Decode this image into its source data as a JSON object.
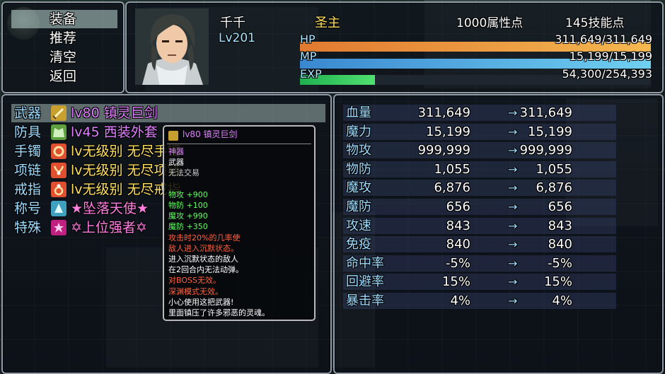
{
  "menu": {
    "items": [
      {
        "label": "装备",
        "selected": true
      },
      {
        "label": "推荐"
      },
      {
        "label": "清空"
      },
      {
        "label": "返回"
      }
    ]
  },
  "character": {
    "name": "千千",
    "title": "圣主",
    "level": "Lv201",
    "attribute_points": "1000属性点",
    "skill_points": "145技能点",
    "hp_label": "HP",
    "hp_value": "311,649/311,649",
    "hp_ratio": 1.0,
    "mp_label": "MP",
    "mp_value": "15,199/15,199",
    "mp_ratio": 1.0,
    "exp_label": "EXP",
    "exp_value": "54,300/254,393",
    "exp_ratio": 0.2134,
    "colors": {
      "hp": "#f0a040",
      "mp": "#50b8e8",
      "exp": "#30d060",
      "title": "#ffe060",
      "level": "#a9e4ff"
    }
  },
  "equipment": {
    "slots": [
      {
        "label": "武器",
        "item": "lv80 镇灵巨剑",
        "icon": "sword-icon",
        "icon_color": "#c8a030",
        "item_color": "#e080ff",
        "selected": true
      },
      {
        "label": "防具",
        "item": "lv45 西装外套",
        "icon": "armor-icon",
        "icon_color": "#60a040",
        "item_color": "#e080ff"
      },
      {
        "label": "手镯",
        "item": "lv无级别 无尽手镯",
        "icon": "bracelet-icon",
        "icon_color": "#e05030",
        "item_color": "#ffe060"
      },
      {
        "label": "项链",
        "item": "lv无级别 无尽项链",
        "icon": "necklace-icon",
        "icon_color": "#e05030",
        "item_color": "#ffe060"
      },
      {
        "label": "戒指",
        "item": "lv无级别 无尽戒指",
        "icon": "ring-icon",
        "icon_color": "#e05030",
        "item_color": "#ffe060"
      },
      {
        "label": "称号",
        "item": "★坠落天使★",
        "icon": "title-icon",
        "icon_color": "#40a0c0",
        "item_color": "#ff80e0"
      },
      {
        "label": "特殊",
        "item": "✡上位强者✡",
        "icon": "special-icon",
        "icon_color": "#c02080",
        "item_color": "#ff80e0"
      }
    ]
  },
  "tooltip": {
    "header": "lv80 镇灵巨剑",
    "lines": [
      {
        "text": "神器",
        "color": "#e080ff"
      },
      {
        "text": "武器",
        "color": "#ffffff"
      },
      {
        "text": "无法交易",
        "color": "#cccccc"
      },
      {
        "text": "",
        "color": "#ffffff"
      },
      {
        "text": "物攻 +900",
        "color": "#60ff60"
      },
      {
        "text": "物防 +100",
        "color": "#60ff60"
      },
      {
        "text": "魔攻 +990",
        "color": "#60ff60"
      },
      {
        "text": "魔防 +350",
        "color": "#60ff60"
      },
      {
        "text": "攻击时20%的几率使",
        "color": "#ff6040"
      },
      {
        "text": "敌人进入沉默状态。",
        "color": "#ff6040"
      },
      {
        "text": "进入沉默状态的敌人",
        "color": "#ffffff"
      },
      {
        "text": "在2回合内无法动弹。",
        "color": "#ffffff"
      },
      {
        "text": "对BOSS无效。",
        "color": "#ff6040"
      },
      {
        "text": "深渊模式无效。",
        "color": "#ff6040"
      },
      {
        "text": "小心使用这把武器!",
        "color": "#ffffff"
      },
      {
        "text": "里面镇压了许多邪恶的灵魂。",
        "color": "#ffffff"
      }
    ]
  },
  "params": {
    "rows": [
      {
        "name": "血量",
        "old": "311,649",
        "new": "311,649"
      },
      {
        "name": "魔力",
        "old": "15,199",
        "new": "15,199"
      },
      {
        "name": "物攻",
        "old": "999,999",
        "new": "999,999"
      },
      {
        "name": "物防",
        "old": "1,055",
        "new": "1,055"
      },
      {
        "name": "魔攻",
        "old": "6,876",
        "new": "6,876"
      },
      {
        "name": "魔防",
        "old": "656",
        "new": "656"
      },
      {
        "name": "攻速",
        "old": "843",
        "new": "843"
      },
      {
        "name": "免疫",
        "old": "840",
        "new": "840"
      },
      {
        "name": "命中率",
        "old": "-5%",
        "new": "-5%"
      },
      {
        "name": "回避率",
        "old": "15%",
        "new": "15%"
      },
      {
        "name": "暴击率",
        "old": "4%",
        "new": "4%"
      }
    ],
    "arrow": "→"
  }
}
